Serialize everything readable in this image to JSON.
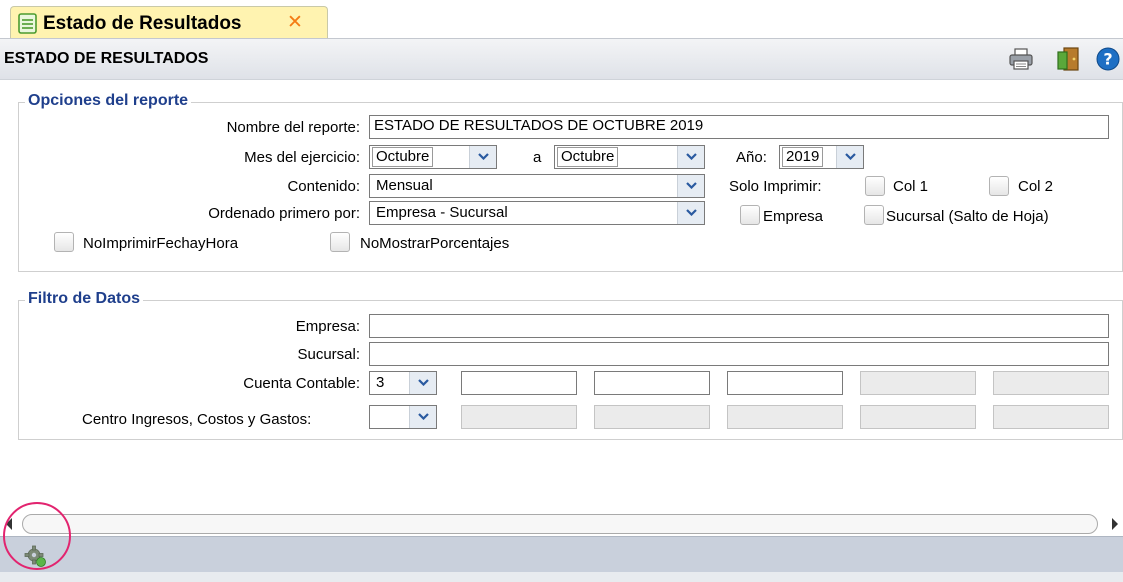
{
  "tab": {
    "title": "Estado de Resultados",
    "close_glyph": "✕"
  },
  "header": {
    "title": "ESTADO DE RESULTADOS",
    "icons": [
      "print-icon",
      "exit-door-icon",
      "help-icon"
    ]
  },
  "opciones": {
    "legend": "Opciones del reporte",
    "nombre_label": "Nombre del reporte:",
    "nombre_value": "ESTADO DE RESULTADOS DE OCTUBRE 2019",
    "mes_label": "Mes del ejercicio:",
    "mes_from": "Octubre",
    "a_label": "a",
    "mes_to": "Octubre",
    "anio_label": "Año:",
    "anio_value": "2019",
    "contenido_label": "Contenido:",
    "contenido_value": "Mensual",
    "solo_imprimir_label": "Solo Imprimir:",
    "col1_label": "Col 1",
    "col2_label": "Col 2",
    "ordenado_label": "Ordenado primero por:",
    "ordenado_value": "Empresa - Sucursal",
    "empresa_cb_label": "Empresa",
    "sucursal_cb_label": "Sucursal (Salto de Hoja)",
    "no_fecha_label": "NoImprimirFechayHora",
    "no_porcentajes_label": "NoMostrarPorcentajes"
  },
  "filtro": {
    "legend": "Filtro de Datos",
    "empresa_label": "Empresa:",
    "empresa_value": "",
    "sucursal_label": "Sucursal:",
    "sucursal_value": "",
    "cuenta_label": "Cuenta Contable:",
    "cuenta_level": "3",
    "centro_label": "Centro Ingresos, Costos y Gastos:",
    "centro_level": ""
  },
  "colors": {
    "tab_bg": "#fff3b0",
    "legend": "#1f3f8c",
    "close": "#f47b14",
    "footer": "#c9d0dc",
    "ring": "#e2246f"
  }
}
